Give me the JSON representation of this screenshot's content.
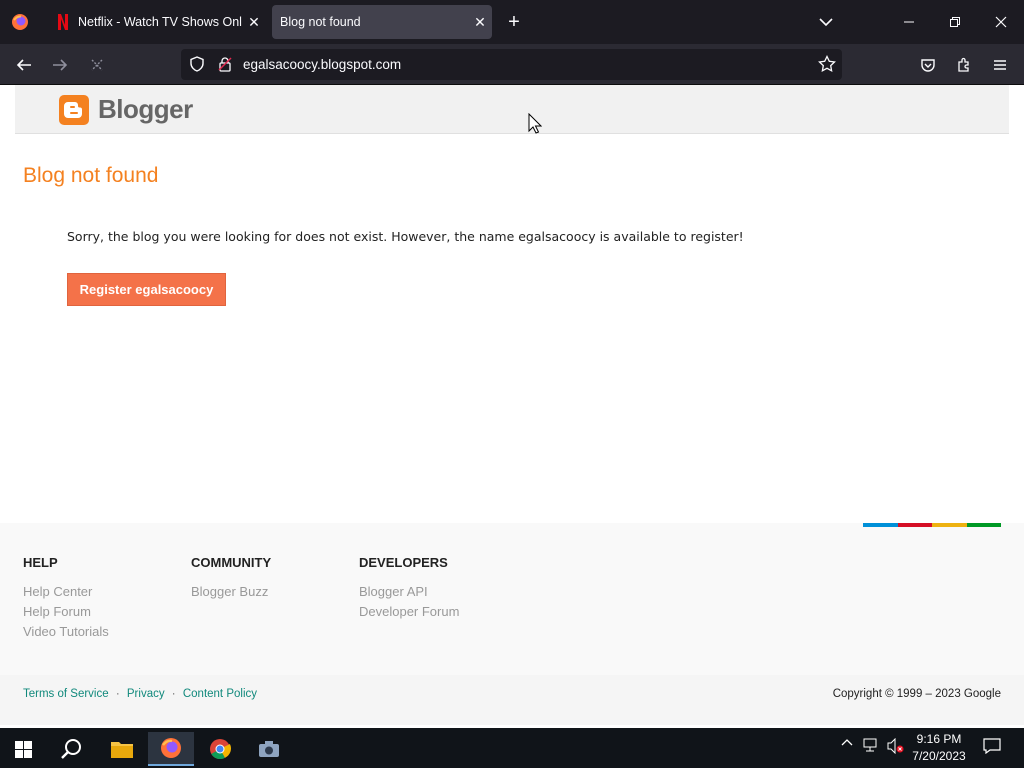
{
  "browser": {
    "tabs": [
      {
        "title": "Netflix - Watch TV Shows Online",
        "active": false
      },
      {
        "title": "Blog not found",
        "active": true
      }
    ],
    "url": "egalsacoocy.blogspot.com"
  },
  "page": {
    "logo_text": "Blogger",
    "title": "Blog not found",
    "message": "Sorry, the blog you were looking for does not exist. However, the name egalsacoocy is available to register!",
    "register_button": "Register egalsacoocy",
    "footer": {
      "help": {
        "heading": "HELP",
        "links": [
          "Help Center",
          "Help Forum",
          "Video Tutorials"
        ]
      },
      "community": {
        "heading": "COMMUNITY",
        "links": [
          "Blogger Buzz"
        ]
      },
      "developers": {
        "heading": "DEVELOPERS",
        "links": [
          "Blogger API",
          "Developer Forum"
        ]
      }
    },
    "legal": {
      "terms": "Terms of Service",
      "privacy": "Privacy",
      "content_policy": "Content Policy",
      "separator": "·",
      "copyright": "Copyright © 1999 – 2023 Google"
    },
    "colors": {
      "brand": "#f48120",
      "button": "#f47249",
      "google_bar": [
        "#0090d8",
        "#d50f25",
        "#eeb211",
        "#009925"
      ]
    }
  },
  "taskbar": {
    "time": "9:16 PM",
    "date": "7/20/2023",
    "apps": [
      "windows-start",
      "search",
      "file-explorer",
      "firefox",
      "chrome",
      "camera"
    ]
  }
}
